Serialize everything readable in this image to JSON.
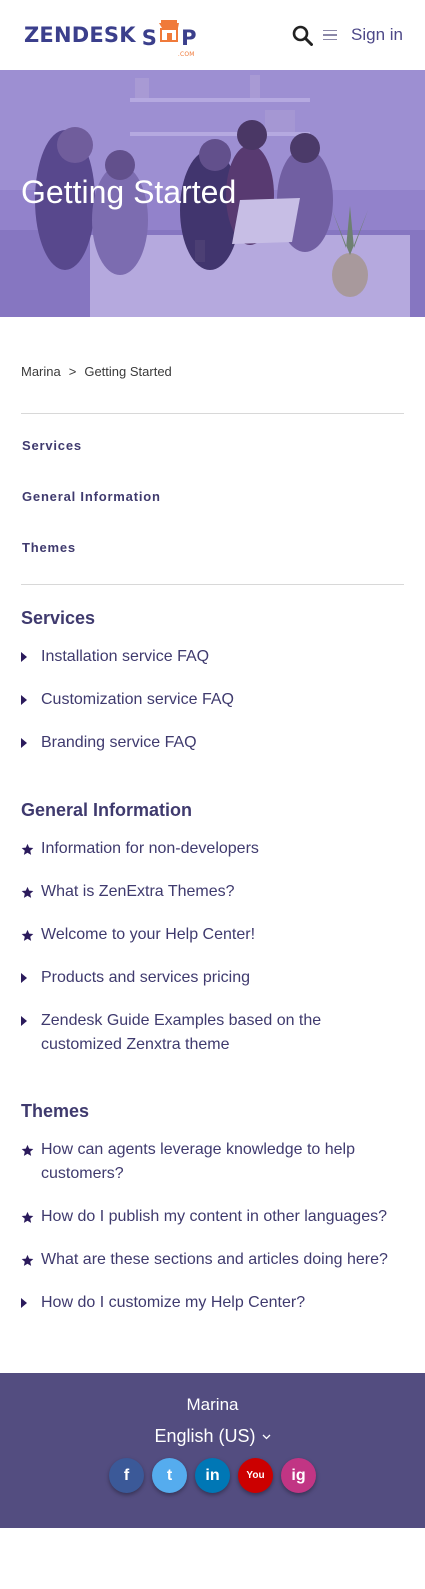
{
  "header": {
    "logo_word1": "ZENDESK",
    "logo_word2_pre": "S",
    "logo_word2_post": "P",
    "logo_dotcom": ".COM",
    "signin_label": "Sign in"
  },
  "hero": {
    "title": "Getting Started"
  },
  "breadcrumb": {
    "home": "Marina",
    "separator": ">",
    "current": "Getting Started"
  },
  "section_nav": [
    "Services",
    "General Information",
    "Themes"
  ],
  "sections": [
    {
      "title": "Services",
      "articles": [
        {
          "title": "Installation service FAQ",
          "icon": "caret-right-icon"
        },
        {
          "title": "Customization service FAQ",
          "icon": "caret-right-icon"
        },
        {
          "title": "Branding service FAQ",
          "icon": "caret-right-icon"
        }
      ]
    },
    {
      "title": "General Information",
      "articles": [
        {
          "title": "Information for non-developers",
          "icon": "star-icon"
        },
        {
          "title": "What is ZenExtra Themes?",
          "icon": "star-icon"
        },
        {
          "title": "Welcome to your Help Center!",
          "icon": "star-icon"
        },
        {
          "title": "Products and services pricing",
          "icon": "caret-right-icon"
        },
        {
          "title": "Zendesk Guide Examples based on the customized Zenxtra theme",
          "icon": "caret-right-icon"
        }
      ]
    },
    {
      "title": "Themes",
      "articles": [
        {
          "title": "How can agents leverage knowledge to help customers?",
          "icon": "star-icon"
        },
        {
          "title": "How do I publish my content in other languages?",
          "icon": "star-icon"
        },
        {
          "title": "What are these sections and articles doing here?",
          "icon": "star-icon"
        },
        {
          "title": "How do I customize my Help Center?",
          "icon": "caret-right-icon"
        }
      ]
    }
  ],
  "footer": {
    "brand": "Marina",
    "language": "English (US)",
    "social": [
      {
        "name": "facebook-icon",
        "glyph": "f",
        "color": "#3b5998"
      },
      {
        "name": "twitter-icon",
        "glyph": "t",
        "color": "#55acee"
      },
      {
        "name": "linkedin-icon",
        "glyph": "in",
        "color": "#0077b5"
      },
      {
        "name": "youtube-icon",
        "glyph": "You",
        "color": "#cc0000"
      },
      {
        "name": "instagram-icon",
        "glyph": "ig",
        "color": "#c13584"
      }
    ]
  },
  "colors": {
    "primary": "#3f3a6e",
    "footer_bg": "#534d80",
    "hero_overlay": "#7b62c9",
    "icon": "#2b1b5c"
  }
}
